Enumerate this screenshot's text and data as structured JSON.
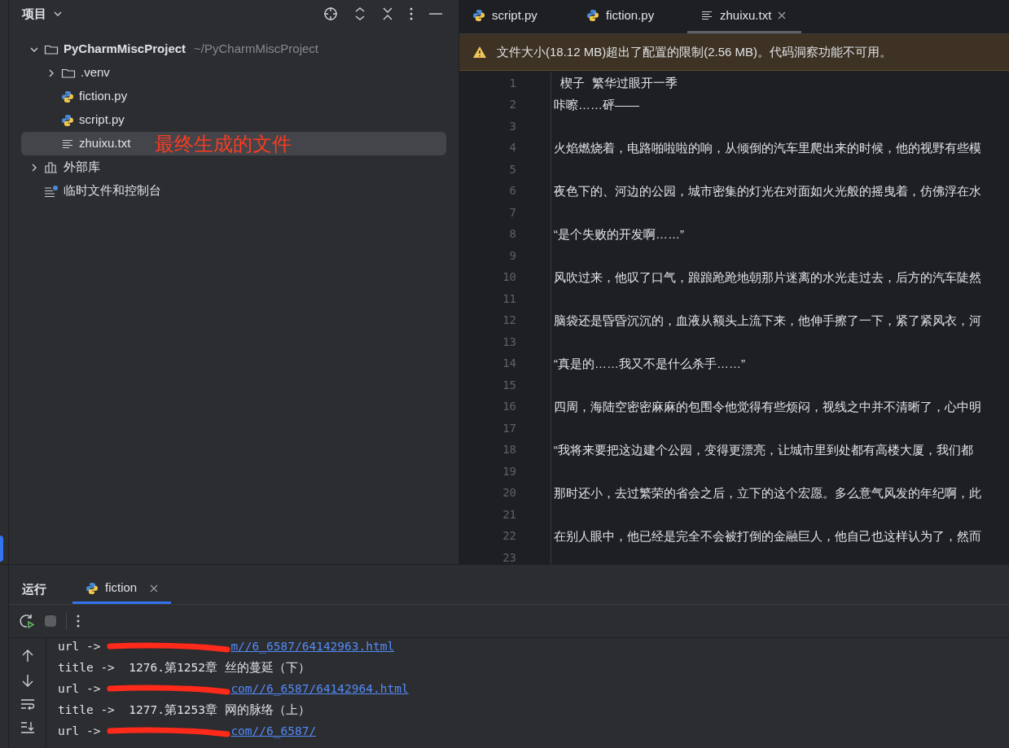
{
  "project_panel": {
    "title": "项目",
    "tree": [
      {
        "label": "PyCharmMiscProject",
        "path": "~/PyCharmMiscProject",
        "kind": "folder",
        "expanded": true,
        "selected": false,
        "children": [
          {
            "label": ".venv",
            "kind": "folder",
            "expanded": false,
            "selected": false
          },
          {
            "label": "fiction.py",
            "kind": "python",
            "selected": false
          },
          {
            "label": "script.py",
            "kind": "python",
            "selected": false
          },
          {
            "label": "zhuixu.txt",
            "kind": "text",
            "selected": true,
            "annotation": "最终生成的文件"
          }
        ]
      },
      {
        "label": "外部库",
        "kind": "library",
        "expanded": false,
        "selected": false
      },
      {
        "label": "临时文件和控制台",
        "kind": "scratch",
        "selected": false
      }
    ]
  },
  "editor": {
    "tabs": [
      {
        "label": "script.py",
        "kind": "python",
        "selected": false
      },
      {
        "label": "fiction.py",
        "kind": "python",
        "selected": false
      },
      {
        "label": "zhuixu.txt",
        "kind": "text",
        "selected": true
      }
    ],
    "warning": "文件大小(18.12 MB)超出了配置的限制(2.56 MB)。代码洞察功能不可用。",
    "lines": [
      {
        "number": "1",
        "text": "  楔子  繁华过眼开一季"
      },
      {
        "number": "2",
        "text": "咔嚓……砰——"
      },
      {
        "number": "3"
      },
      {
        "number": "4",
        "text": "火焰燃烧着，电路啪啦啦的响，从倾倒的汽车里爬出来的时候，他的视野有些模"
      },
      {
        "number": "5"
      },
      {
        "number": "6",
        "text": "夜色下的、河边的公园，城市密集的灯光在对面如火光般的摇曳着，仿佛浮在水"
      },
      {
        "number": "7"
      },
      {
        "number": "8",
        "text": "“是个失败的开发啊……”"
      },
      {
        "number": "9"
      },
      {
        "number": "10",
        "text": "风吹过来，他叹了口气，踉踉跄跄地朝那片迷离的水光走过去，后方的汽车陡然"
      },
      {
        "number": "11"
      },
      {
        "number": "12",
        "text": "脑袋还是昏昏沉沉的，血液从额头上流下来，他伸手擦了一下，紧了紧风衣，河"
      },
      {
        "number": "13"
      },
      {
        "number": "14",
        "text": "“真是的……我又不是什么杀手……”"
      },
      {
        "number": "15"
      },
      {
        "number": "16",
        "text": "四周，海陆空密密麻麻的包围令他觉得有些烦闷，视线之中并不清晰了，心中明"
      },
      {
        "number": "17"
      },
      {
        "number": "18",
        "text": "“我将来要把这边建个公园，变得更漂亮，让城市里到处都有高楼大厦，我们都"
      },
      {
        "number": "19"
      },
      {
        "number": "20",
        "text": "那时还小，去过繁荣的省会之后，立下的这个宏愿。多么意气风发的年纪啊，此"
      },
      {
        "number": "21"
      },
      {
        "number": "22",
        "text": "在别人眼中，他已经是完全不会被打倒的金融巨人，他自己也这样认为了，然而"
      },
      {
        "number": "23"
      }
    ]
  },
  "run_panel": {
    "title": "运行",
    "tabs": [
      {
        "label": "fiction",
        "selected": true
      }
    ],
    "output": [
      {
        "kind": "url",
        "prefix": "url ->",
        "link": "m//6_6587/64142963.html",
        "redacted": true
      },
      {
        "kind": "title",
        "text": "title ->  1276.第1252章 丝的蔓延（下）"
      },
      {
        "kind": "url",
        "prefix": "url ->",
        "link": "com//6_6587/64142964.html",
        "redacted": true
      },
      {
        "kind": "title",
        "text": "title ->  1277.第1253章 网的脉络（上）"
      },
      {
        "kind": "url",
        "prefix": "url ->",
        "link": "com//6_6587/",
        "redacted": true
      }
    ]
  }
}
